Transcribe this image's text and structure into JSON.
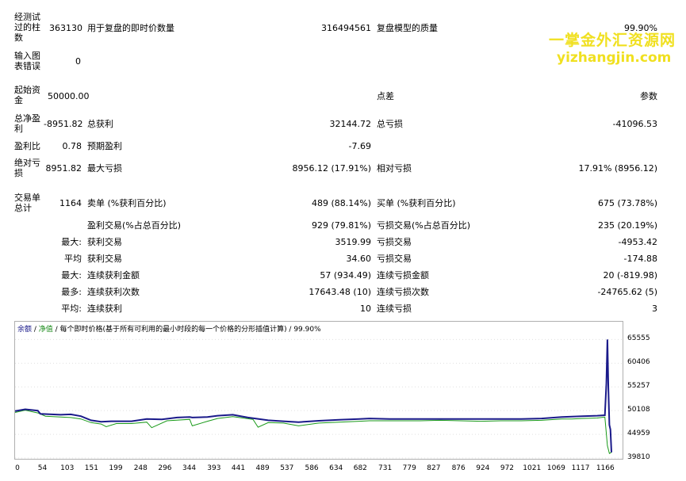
{
  "watermark": {
    "line1": "一掌金外汇资源网",
    "line2": "yizhangjin.com"
  },
  "report": {
    "bars_label": "经测试过的柱数",
    "bars_value": "363130",
    "ticks_label": "用于复盘的即时价数量",
    "ticks_value": "316494561",
    "quality_label": "复盘模型的质量",
    "quality_value": "99.90%",
    "mismatch_label": "输入图表错误",
    "mismatch_value": "0",
    "deposit_label": "起始资金",
    "deposit_value": "50000.00",
    "spread_label": "点差",
    "params_label": "参数",
    "net_label": "总净盈利",
    "net_value": "-8951.82",
    "gross_profit_label": "总获利",
    "gross_profit_value": "32144.72",
    "gross_loss_label": "总亏损",
    "gross_loss_value": "-41096.53",
    "pf_label": "盈利比",
    "pf_value": "0.78",
    "payoff_label": "预期盈利",
    "payoff_value": "-7.69",
    "abs_dd_label": "绝对亏损",
    "abs_dd_value": "8951.82",
    "max_dd_label": "最大亏损",
    "max_dd_value": "8956.12 (17.91%)",
    "rel_dd_label": "相对亏损",
    "rel_dd_value": "17.91% (8956.12)",
    "total_trades_label": "交易单总计",
    "total_trades_value": "1164",
    "short_label": "卖单 (%获利百分比)",
    "short_value": "489 (88.14%)",
    "long_label": "买单 (%获利百分比)",
    "long_value": "675 (73.78%)",
    "profit_trades_label": "盈利交易(%占总百分比)",
    "profit_trades_value": "929 (79.81%)",
    "loss_trades_label": "亏损交易(%占总百分比)",
    "loss_trades_value": "235 (20.19%)",
    "largest_prefix": "最大:",
    "largest_profit_label": "获利交易",
    "largest_profit_value": "3519.99",
    "largest_loss_label": "亏损交易",
    "largest_loss_value": "-4953.42",
    "avg_prefix": "平均",
    "avg_profit_label": "获利交易",
    "avg_profit_value": "34.60",
    "avg_loss_label": "亏损交易",
    "avg_loss_value": "-174.88",
    "max_cons_prefix": "最大:",
    "max_cons_wins_label": "连续获利金额",
    "max_cons_wins_value": "57 (934.49)",
    "max_cons_losses_label": "连续亏损金额",
    "max_cons_losses_value": "20 (-819.98)",
    "maximal_prefix": "最多:",
    "maximal_wins_label": "连续获利次数",
    "maximal_wins_value": "17643.48 (10)",
    "maximal_losses_label": "连续亏损次数",
    "maximal_losses_value": "-24765.62 (5)",
    "avg_cons_prefix": "平均:",
    "avg_cons_wins_label": "连续获利",
    "avg_cons_wins_value": "10",
    "avg_cons_losses_label": "连续亏损",
    "avg_cons_losses_value": "3"
  },
  "chart_data": {
    "type": "line",
    "legend_balance": "余额",
    "legend_sep": " / ",
    "legend_equity": "净值",
    "legend_rest": " / 每个即时价格(基于所有可利用的最小时段的每一个价格的分形插值计算) / 99.90%",
    "colors": {
      "balance": "#1a1a8a",
      "equity": "#1a9a1a"
    },
    "ylim": [
      39810,
      67000
    ],
    "xlim": [
      0,
      1200
    ],
    "yticks": [
      "65555",
      "60406",
      "55257",
      "50108",
      "44959",
      "39810"
    ],
    "ytick_values": [
      65555,
      60406,
      55257,
      50108,
      44959,
      39810
    ],
    "xticks": [
      "0",
      "54",
      "103",
      "151",
      "199",
      "248",
      "296",
      "344",
      "393",
      "441",
      "489",
      "537",
      "586",
      "634",
      "682",
      "731",
      "779",
      "827",
      "876",
      "924",
      "972",
      "1021",
      "1069",
      "1117",
      "1166"
    ],
    "series": [
      {
        "key": "balance",
        "x": [
          0,
          20,
          45,
          50,
          90,
          110,
          130,
          150,
          170,
          190,
          230,
          260,
          290,
          320,
          345,
          350,
          380,
          400,
          430,
          460,
          500,
          530,
          560,
          600,
          640,
          680,
          700,
          740,
          780,
          800,
          840,
          880,
          920,
          960,
          1000,
          1040,
          1080,
          1100,
          1120,
          1150,
          1165,
          1168,
          1170,
          1172,
          1174,
          1176,
          1178
        ],
        "y": [
          50000,
          50400,
          50100,
          49400,
          49200,
          49300,
          48900,
          48000,
          47700,
          47800,
          47800,
          48300,
          48200,
          48600,
          48700,
          48600,
          48700,
          49000,
          49200,
          48600,
          48000,
          47800,
          47600,
          47900,
          48100,
          48300,
          48400,
          48300,
          48300,
          48300,
          48300,
          48300,
          48300,
          48300,
          48300,
          48400,
          48700,
          48800,
          48900,
          49000,
          49100,
          56000,
          65555,
          55000,
          47000,
          46000,
          41048
        ]
      },
      {
        "key": "equity",
        "x": [
          0,
          20,
          45,
          60,
          90,
          110,
          130,
          150,
          170,
          180,
          200,
          230,
          260,
          270,
          300,
          345,
          350,
          380,
          400,
          430,
          470,
          480,
          500,
          530,
          560,
          600,
          640,
          680,
          700,
          740,
          780,
          800,
          840,
          880,
          920,
          960,
          1000,
          1040,
          1080,
          1100,
          1120,
          1150,
          1165,
          1170,
          1174,
          1178
        ],
        "y": [
          49700,
          50200,
          49600,
          48900,
          48700,
          48600,
          48300,
          47500,
          47200,
          46600,
          47300,
          47300,
          47600,
          46400,
          47900,
          48200,
          46800,
          47800,
          48400,
          48800,
          48200,
          46500,
          47500,
          47400,
          46800,
          47400,
          47600,
          47800,
          47900,
          47900,
          47900,
          47900,
          48000,
          47900,
          47800,
          47900,
          47900,
          48000,
          48300,
          48300,
          48400,
          48500,
          48700,
          42500,
          40800,
          41048
        ]
      }
    ]
  }
}
